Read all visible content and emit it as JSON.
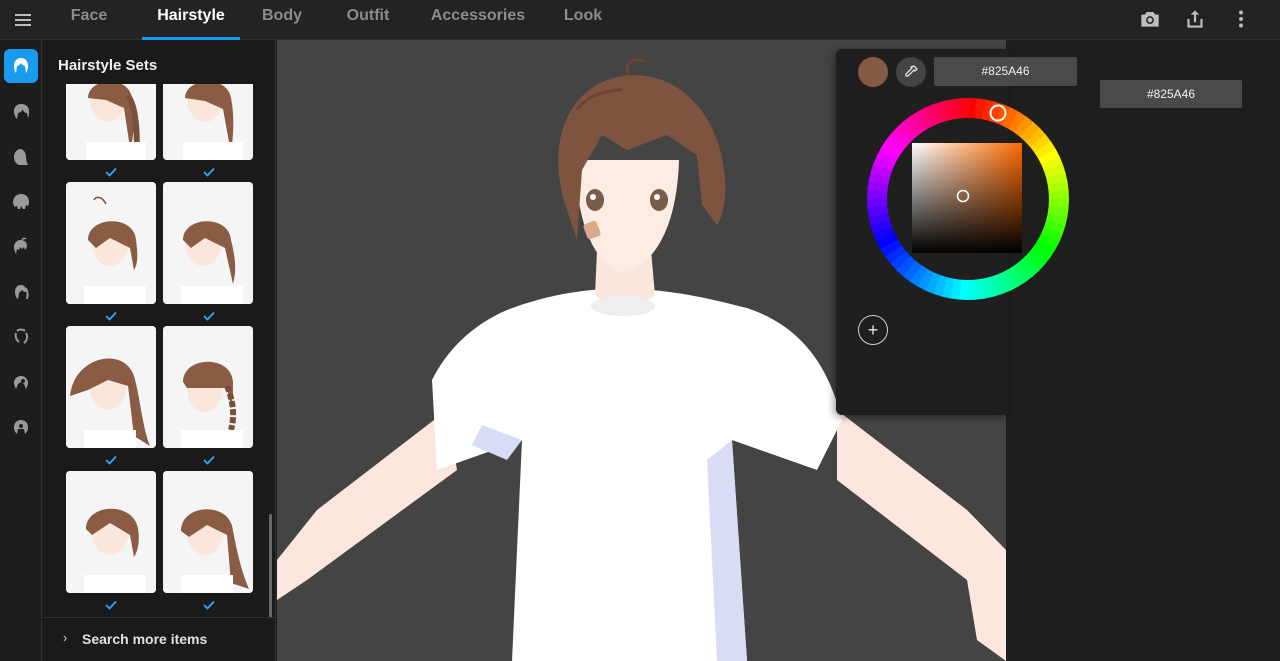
{
  "topbar": {
    "tabs": [
      {
        "label": "Face",
        "active": false
      },
      {
        "label": "Hairstyle",
        "active": true
      },
      {
        "label": "Body",
        "active": false
      },
      {
        "label": "Outfit",
        "active": false
      },
      {
        "label": "Accessories",
        "active": false
      },
      {
        "label": "Look",
        "active": false
      }
    ],
    "icons": [
      "menu-icon",
      "camera-icon",
      "share-icon",
      "more-vertical-icon"
    ]
  },
  "rail": {
    "items": [
      "hairstyle-sets-icon",
      "front-hair-icon",
      "back-hair-icon",
      "side-hair-icon",
      "ahoge-icon",
      "ponytail-icon",
      "braid-icon",
      "bun-icon",
      "extra-hair-icon"
    ],
    "active_index": 0
  },
  "panel": {
    "title": "Hairstyle Sets",
    "items_count_visible": 8,
    "search_more_label": "Search more items"
  },
  "color_picker": {
    "current_color": "#825A46",
    "hex_value": "#825A46",
    "secondary_hex_value": "#825A46"
  },
  "colors": {
    "accent": "#1a9bf0",
    "viewport_bg": "#444444",
    "hair": "#825A46"
  }
}
